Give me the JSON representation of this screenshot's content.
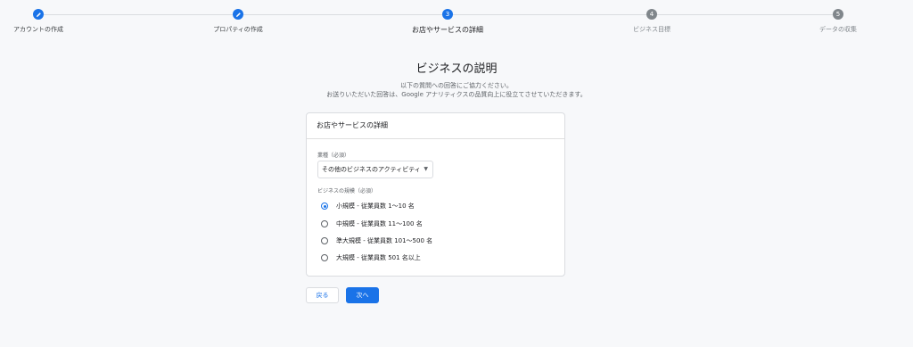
{
  "stepper": {
    "steps": [
      {
        "label": "アカウントの作成",
        "state": "done",
        "icon": "pencil-icon"
      },
      {
        "label": "プロパティの作成",
        "state": "done",
        "icon": "pencil-icon"
      },
      {
        "label": "お店やサービスの詳細",
        "state": "active",
        "number": "3"
      },
      {
        "label": "ビジネス目標",
        "state": "pending",
        "number": "4"
      },
      {
        "label": "データの収集",
        "state": "pending",
        "number": "5"
      }
    ]
  },
  "header": {
    "title": "ビジネスの説明",
    "subtitle_line1": "以下の質問への回答にご協力ください。",
    "subtitle_line2": "お送りいただいた回答は、Google アナリティクスの品質向上に役立てさせていただきます。"
  },
  "card": {
    "title": "お店やサービスの詳細",
    "industry_label": "業種（必須）",
    "industry_value": "その他のビジネスのアクティビティ",
    "size_label": "ビジネスの規模（必須）",
    "size_options": [
      {
        "label": "小規模 - 従業員数 1〜10 名",
        "checked": true
      },
      {
        "label": "中規模 - 従業員数 11〜100 名",
        "checked": false
      },
      {
        "label": "準大規模 - 従業員数 101〜500 名",
        "checked": false
      },
      {
        "label": "大規模 - 従業員数 501 名以上",
        "checked": false
      }
    ]
  },
  "buttons": {
    "back_label": "戻る",
    "next_label": "次へ"
  },
  "colors": {
    "accent": "#1a73e8",
    "pending": "#80868b",
    "background": "#f7f8fa"
  }
}
